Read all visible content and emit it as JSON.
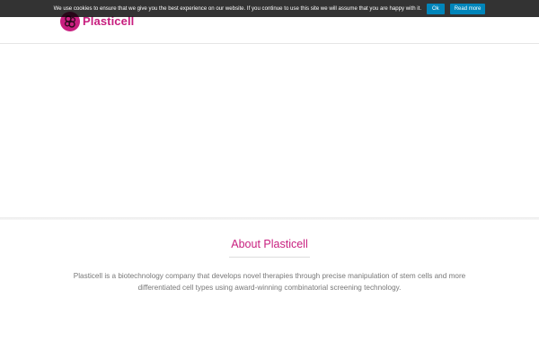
{
  "header": {
    "logo_text": "Plasticell"
  },
  "cookie_bar": {
    "message": "We use cookies to ensure that we give you the best experience on our website. If you continue to use this site we will assume that you are happy with it.",
    "ok_label": "Ok",
    "read_more_label": "Read more"
  },
  "about": {
    "title": "About Plasticell",
    "body": "Plasticell is a biotechnology company that develops novel therapies through precise manipulation of stem cells and more differentiated cell types using award-winning combinatorial screening technology."
  },
  "colors": {
    "brand": "#c81f7f",
    "cookie_button": "#0085ba",
    "body_text": "#777777"
  },
  "icons": {
    "logo": "plasticell-logo-icon"
  }
}
